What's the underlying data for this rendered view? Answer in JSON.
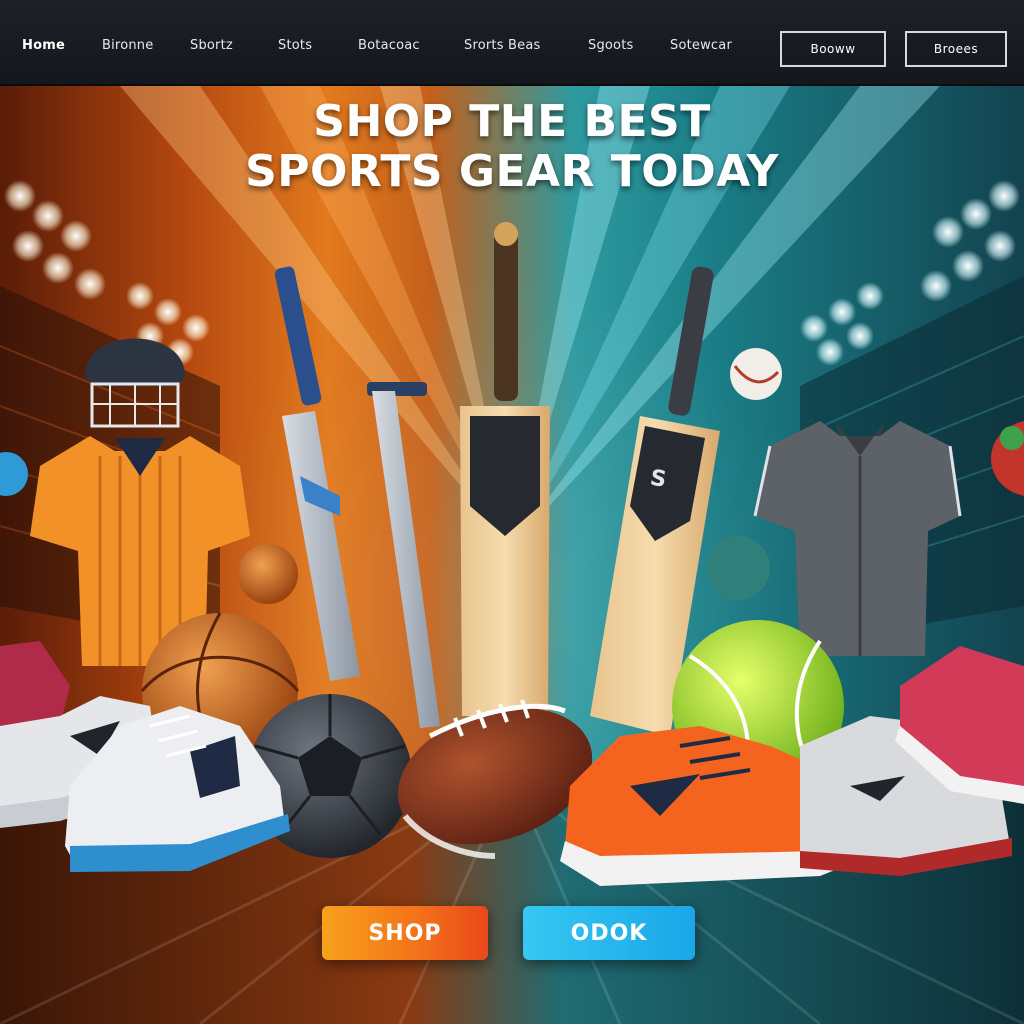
{
  "nav": {
    "links": [
      "Home",
      "Bironne",
      "Sbortz",
      "Stots",
      "Botacoac",
      "Srorts Beas",
      "Sgoots",
      "Sotewcar"
    ],
    "button_primary": "Booww",
    "button_secondary": "Broees"
  },
  "hero": {
    "title_line1": "SHOP THE BEST",
    "title_line2": "SPORTS GEAR TODAY"
  },
  "cta": {
    "shop_label": "SHOP",
    "second_label": "ODOK"
  },
  "colors": {
    "shop_button": "#f3701a",
    "second_button": "#1aa6e8",
    "nav_background": "#1d2128",
    "warm_side": "#e27a1e",
    "cool_side": "#1a7d86"
  }
}
